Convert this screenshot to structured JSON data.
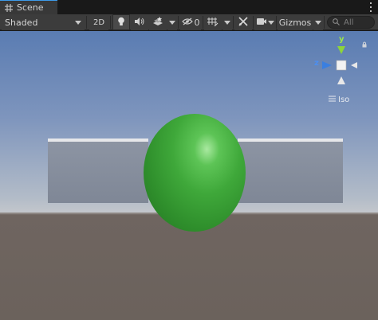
{
  "tab": {
    "title": "Scene",
    "icon": "grid-icon"
  },
  "toolbar": {
    "draw_mode": "Shaded",
    "mode_2d": "2D",
    "hidden_count": "0",
    "gizmos": "Gizmos",
    "search_placeholder": "All"
  },
  "viewport": {
    "orientation_gizmo": {
      "y_label": "y",
      "z_label": "z"
    },
    "projection_label": "Iso"
  },
  "colors": {
    "tab_accent": "#3d9bea",
    "sphere": "#3fa83a",
    "gizmo_y": "#8dd43a",
    "gizmo_z": "#3a7fe0"
  }
}
